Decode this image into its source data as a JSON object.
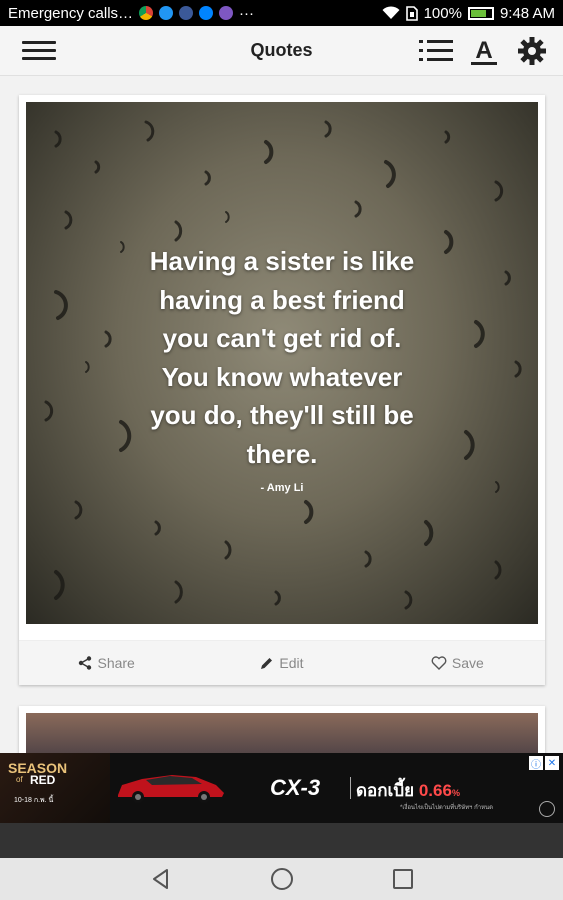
{
  "status_bar": {
    "notification_text": "Emergency calls…",
    "more_indicator": "···",
    "battery_percent": "100%",
    "time": "9:48 AM",
    "icons": [
      "wifi-icon",
      "sim-icon",
      "battery-icon"
    ]
  },
  "app_bar": {
    "title": "Quotes",
    "icons": [
      "menu-icon",
      "list-icon",
      "font-icon",
      "gear-icon"
    ]
  },
  "quote_card": {
    "quote_lines": [
      "Having a sister is like",
      "having a best friend",
      "you can't get rid of.",
      "You know whatever",
      "you do, they'll still be",
      "there."
    ],
    "author": "- Amy Li",
    "actions": {
      "share_label": "Share",
      "edit_label": "Edit",
      "save_label": "Save"
    }
  },
  "ad": {
    "season": "SEASON",
    "season_sub": "of",
    "red": "RED",
    "date": "10-18 ก.พ. นี้",
    "model": "CX-3",
    "offer": "ดอกเบี้ย",
    "rate": "0.66",
    "rate_suffix": "%",
    "disclaimer": "*เงื่อนไขเป็นไปตามที่บริษัทฯ กำหนด"
  },
  "colors": {
    "accent_red": "#ff4a4a",
    "battery_green": "#6bbf3a"
  }
}
